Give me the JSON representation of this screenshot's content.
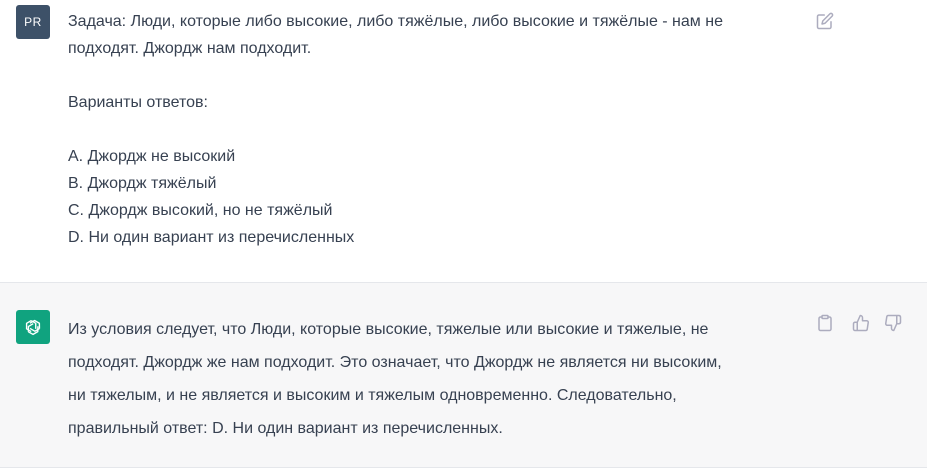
{
  "user_message": {
    "avatar_initials": "PR",
    "lines": [
      "Задача: Люди, которые либо высокие, либо тяжёлые, либо высокие и тяжёлые - нам не",
      "подходят. Джордж нам подходит.",
      "",
      "Варианты ответов:",
      "",
      "A. Джордж не высокий",
      "B. Джордж тяжёлый",
      "C. Джордж высокий, но не тяжёлый",
      "D. Ни один вариант из перечисленных"
    ]
  },
  "assistant_message": {
    "lines": [
      "Из условия следует, что Люди, которые высокие, тяжелые или высокие и тяжелые, не",
      "подходят. Джордж же нам подходит. Это означает, что Джордж не является ни высоким,",
      "ни тяжелым, и не является и высоким и тяжелым одновременно. Следовательно,",
      "правильный ответ: D. Ни один вариант из перечисленных."
    ]
  },
  "icons": {
    "edit": "edit-icon",
    "copy": "copy-icon",
    "thumbs_up": "thumbs-up-icon",
    "thumbs_down": "thumbs-down-icon",
    "assistant_logo": "openai-logo-icon"
  },
  "colors": {
    "user_avatar_bg": "#3d5168",
    "assistant_avatar_bg": "#10a37f",
    "assistant_row_bg": "#f7f7f8",
    "text": "#374151",
    "icon": "#acacbe"
  }
}
